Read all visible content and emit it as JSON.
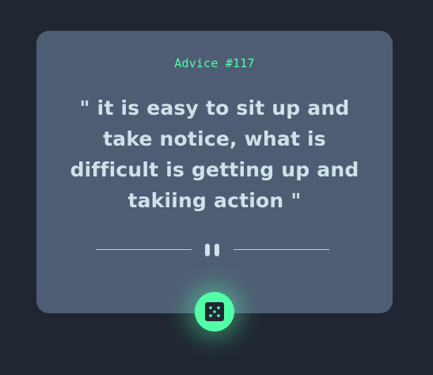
{
  "advice": {
    "title": "Advice #117",
    "quote": "\" it is easy to sit up and take notice, what is difficult is getting up and takiing action \""
  },
  "divider": {
    "icon": "pause-icon"
  },
  "dice_button": {
    "icon": "dice-icon"
  },
  "colors": {
    "background": "#202632",
    "card": "#4f5d74",
    "accent": "#52ffa8",
    "text": "#cee3e9"
  }
}
